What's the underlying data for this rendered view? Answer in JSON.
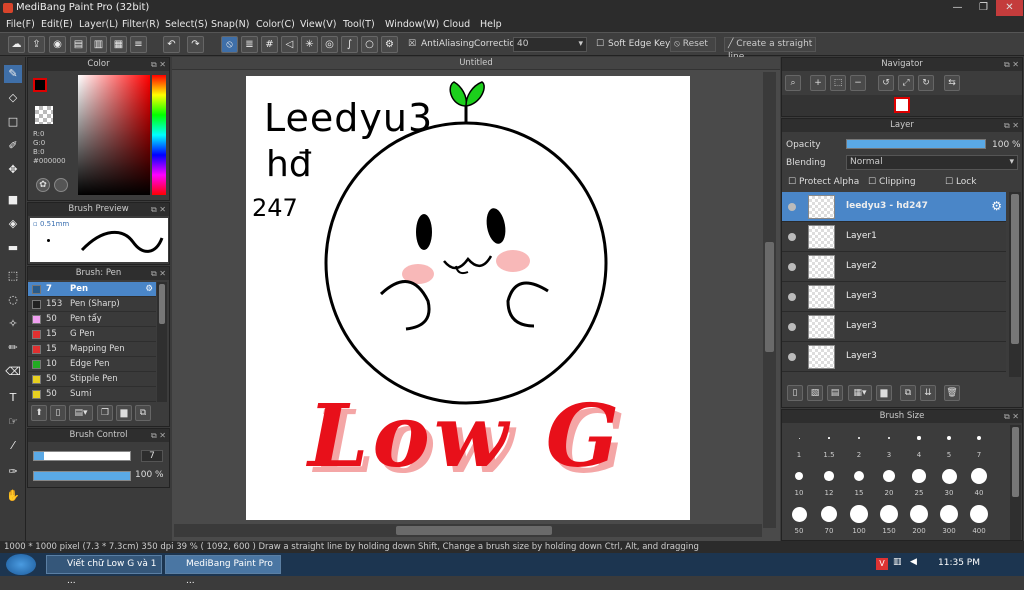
{
  "window": {
    "title": "MediBang Paint Pro (32bit)",
    "minimize": "—",
    "maximize": "❐",
    "close": "✕"
  },
  "menu": [
    "File(F)",
    "Edit(E)",
    "Layer(L)",
    "Filter(R)",
    "Select(S)",
    "Snap(N)",
    "Color(C)",
    "View(V)",
    "Tool(T)",
    "Window(W)",
    "Cloud",
    "Help"
  ],
  "toolbar": {
    "antialiasing": "AntiAliasing",
    "correction_label": "Correction",
    "correction_value": "40",
    "soft_edge": "Soft Edge",
    "key": "Key",
    "reset": "Reset",
    "straight_line": "Create a straight line"
  },
  "color_panel": {
    "title": "Color",
    "r": "R:0",
    "g": "G:0",
    "b": "B:0",
    "hex": "#000000"
  },
  "brush_preview": {
    "title": "Brush Preview",
    "size": "0.51mm"
  },
  "brush_panel": {
    "title": "Brush: Pen",
    "items": [
      {
        "num": "7",
        "name": "Pen",
        "color": "#2a5b8a"
      },
      {
        "num": "153",
        "name": "Pen (Sharp)",
        "color": "#222222"
      },
      {
        "num": "50",
        "name": "Pen tẩy",
        "color": "#f0a0f0"
      },
      {
        "num": "15",
        "name": "G Pen",
        "color": "#e03030"
      },
      {
        "num": "15",
        "name": "Mapping Pen",
        "color": "#e03030"
      },
      {
        "num": "10",
        "name": "Edge Pen",
        "color": "#22aa22"
      },
      {
        "num": "50",
        "name": "Stipple Pen",
        "color": "#e8d020"
      },
      {
        "num": "50",
        "name": "Sumi",
        "color": "#e8d020"
      }
    ]
  },
  "brush_control": {
    "title": "Brush Control",
    "size": "7",
    "opacity": "100 %",
    "size_fraction": 0.1,
    "opacity_fraction": 1.0
  },
  "canvas": {
    "tab": "Untitled",
    "text_top1": "Leedyu3",
    "text_top2": "hđ",
    "text_top3": "247",
    "text_bottom": "Low G"
  },
  "navigator": {
    "title": "Navigator"
  },
  "layer_panel": {
    "title": "Layer",
    "opacity_label": "Opacity",
    "opacity_value": "100 %",
    "blending_label": "Blending",
    "blending_value": "Normal",
    "protect_alpha": "Protect Alpha",
    "clipping": "Clipping",
    "lock": "Lock",
    "layers": [
      "leedyu3 - hd247",
      "Layer1",
      "Layer2",
      "Layer3",
      "Layer3",
      "Layer3"
    ]
  },
  "brush_size": {
    "title": "Brush Size",
    "labels_row1": [
      "1",
      "1.5",
      "2",
      "3",
      "4",
      "5",
      "7"
    ],
    "labels_row2": [
      "10",
      "12",
      "15",
      "20",
      "25",
      "30",
      "40"
    ],
    "labels_row3": [
      "50",
      "70",
      "100",
      "150",
      "200",
      "300",
      "400"
    ]
  },
  "status": "1000 * 1000 pixel   (7.3 * 7.3cm)   350 dpi   39 %   ( 1092, 600 )   Draw a straight line by holding down Shift, Change a brush size by holding down Ctrl, Alt, and dragging",
  "taskbar": {
    "task1": "Viết chữ Low G và 1 ...",
    "task2": "MediBang Paint Pro ...",
    "time": "11:35 PM"
  }
}
